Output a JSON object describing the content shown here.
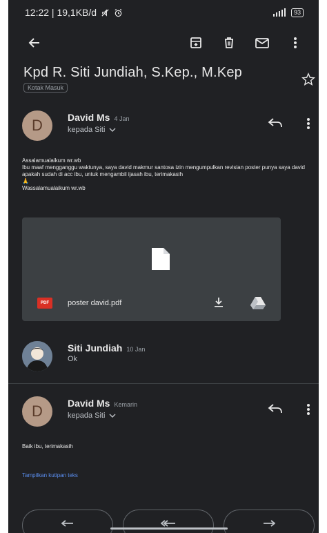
{
  "status": {
    "left": "12:22 | 19,1KB/d",
    "battery": "93"
  },
  "subject": "Kpd R. Siti Jundiah, S.Kep., M.Kep",
  "label": "Kotak Masuk",
  "messages": [
    {
      "initial": "D",
      "sender": "David Ms",
      "date": "4 Jan",
      "to": "kepada Siti",
      "body": [
        "Assalamualaikum wr.wb",
        "Ibu maaf mengganggu waktunya, saya david makmur santosa izin mengumpulkan revisian poster punya saya david apakah sudah di acc ibu, untuk mengambil ijasah ibu, terimakasih",
        "🙏",
        "Wassalamualaikum wr.wb"
      ],
      "attachment": {
        "badge": "PDF",
        "name": "poster david.pdf"
      }
    },
    {
      "sender": "Siti Jundiah",
      "date": "10 Jan",
      "snippet": "Ok"
    },
    {
      "initial": "D",
      "sender": "David Ms",
      "date": "Kemarin",
      "to": "kepada Siti",
      "body": [
        "Baik ibu, terimakasih"
      ],
      "quote_link": "Tampilkan kutipan teks"
    }
  ],
  "colors": {
    "background": "#202124",
    "card": "#3c4043",
    "accent_link": "#5a8ef0",
    "pdf": "#d93025"
  }
}
